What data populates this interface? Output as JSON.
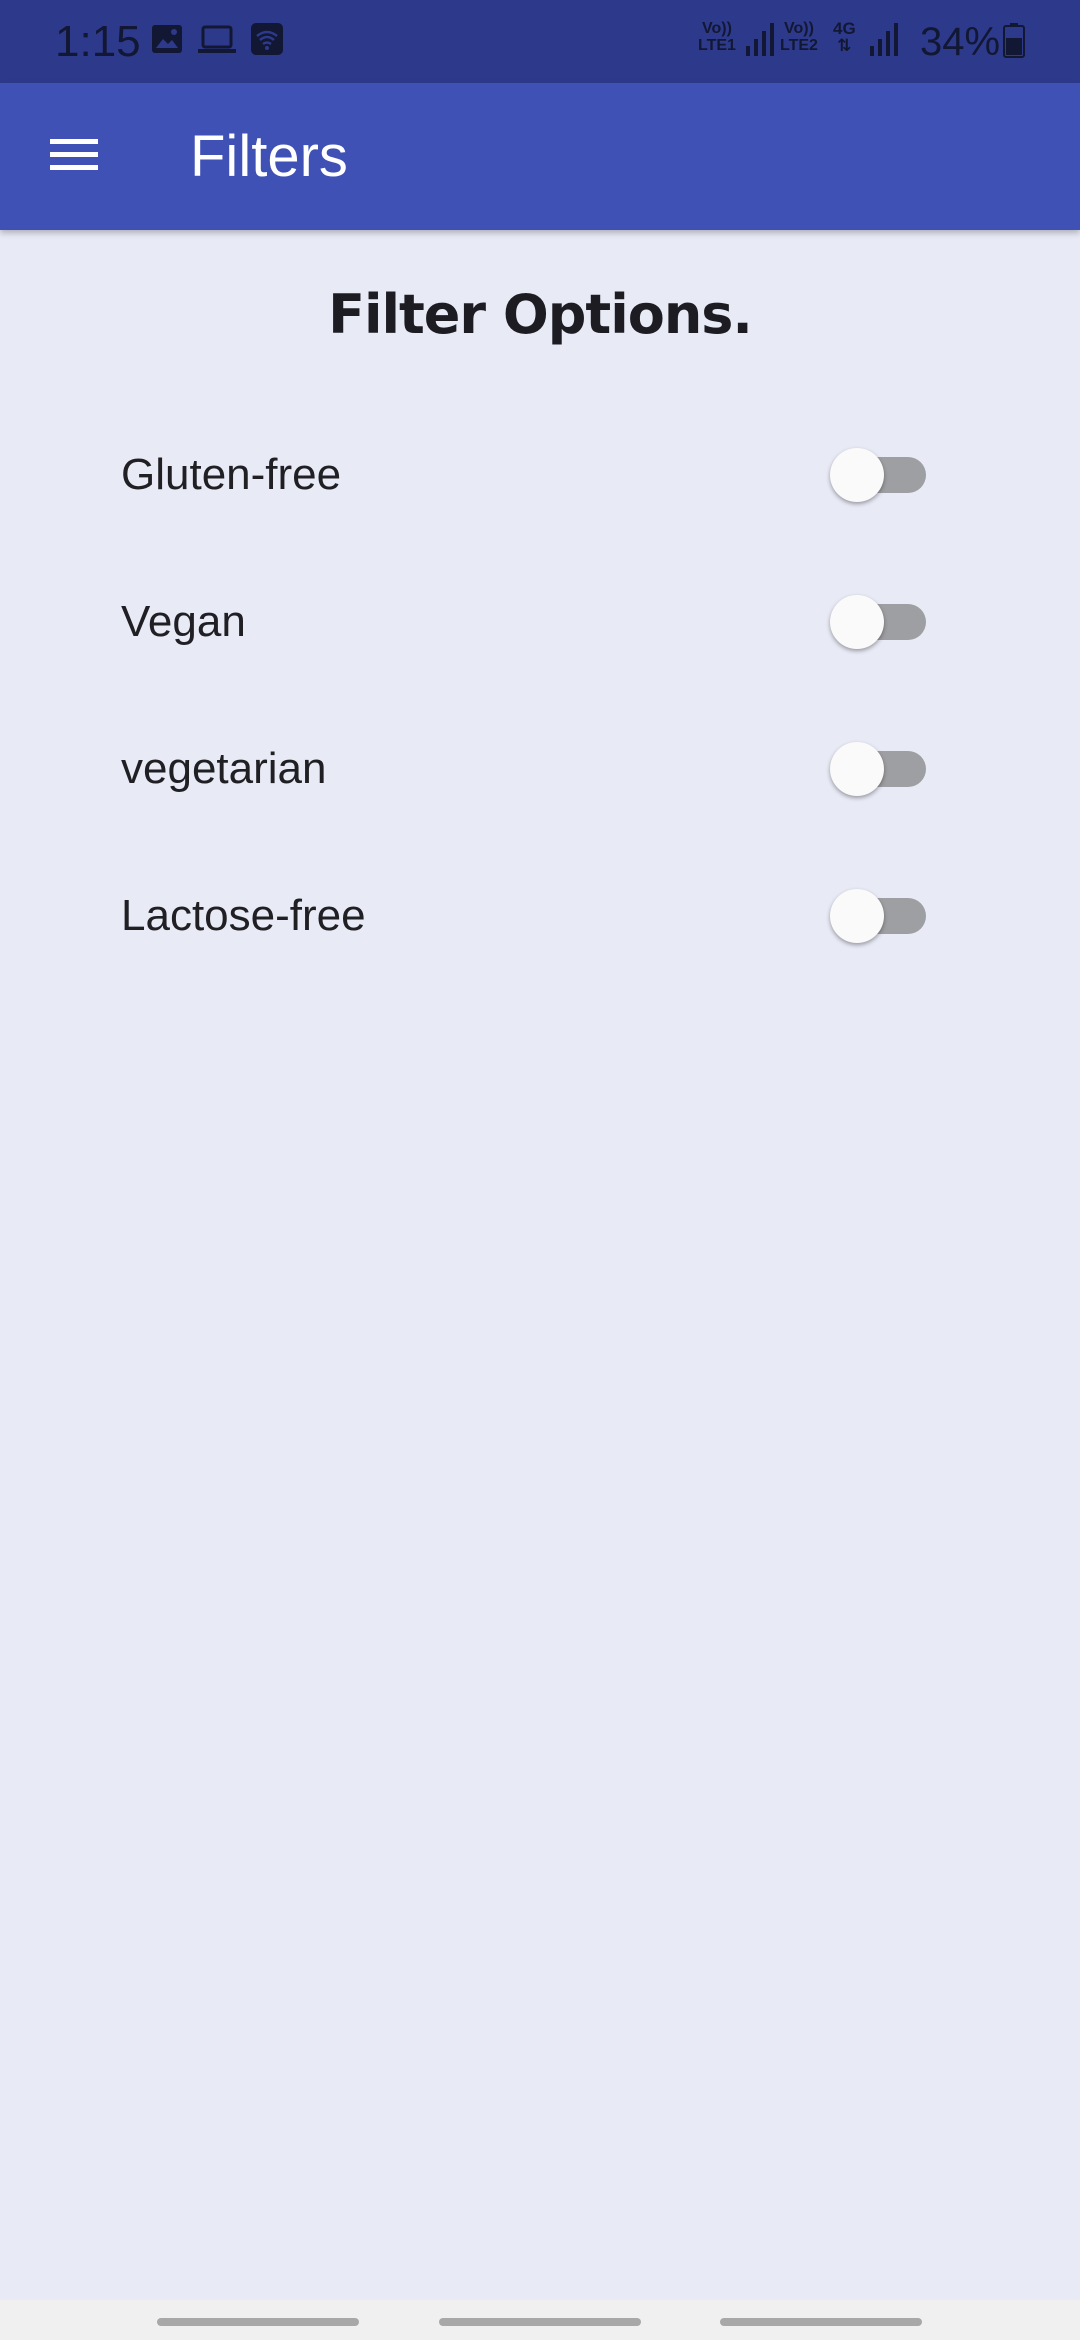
{
  "status_bar": {
    "time": "1:15",
    "battery": "34%",
    "sim1_label_top": "Vo))",
    "sim1_label_bottom": "LTE1",
    "sim2_label_top": "Vo))",
    "sim2_label_bottom": "LTE2",
    "network_type": "4G",
    "icons": [
      "image-icon",
      "laptop-icon",
      "wifi-icon",
      "signal-icon",
      "battery-icon"
    ]
  },
  "app_bar": {
    "title": "Filters",
    "menu_icon": "menu-icon",
    "color": "#3f51b5"
  },
  "content": {
    "heading": "Filter Options.",
    "filters": [
      {
        "label": "Gluten-free",
        "enabled": false
      },
      {
        "label": "Vegan",
        "enabled": false
      },
      {
        "label": "vegetarian",
        "enabled": false
      },
      {
        "label": "Lactose-free",
        "enabled": false
      }
    ]
  },
  "colors": {
    "status_bar": "#2d3a8c",
    "background": "#e8eaf6",
    "switch_track_off": "#9e9fa3",
    "switch_thumb": "#fafafa"
  }
}
